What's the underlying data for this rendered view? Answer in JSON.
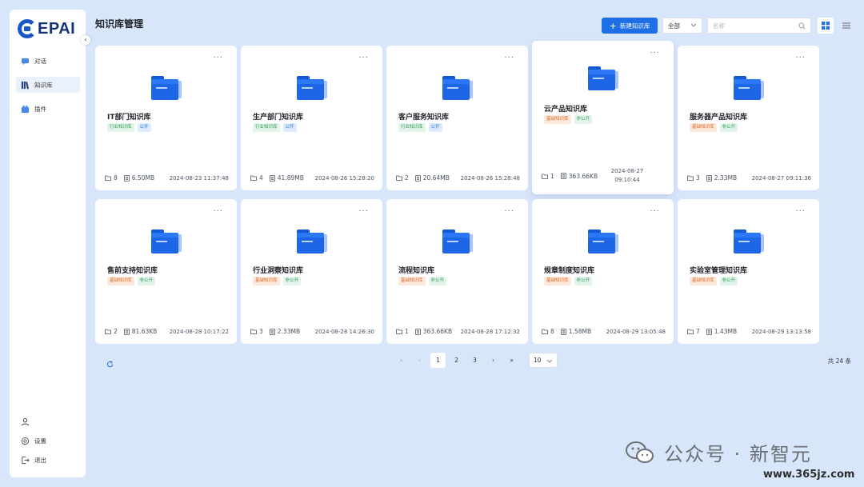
{
  "logo": {
    "text": "EPAI"
  },
  "sidebar": {
    "items": [
      {
        "label": "对话",
        "icon": "chat-icon",
        "active": false
      },
      {
        "label": "知识库",
        "icon": "library-icon",
        "active": true
      },
      {
        "label": "插件",
        "icon": "plugin-icon",
        "active": false
      }
    ],
    "bottom": [
      {
        "label": "",
        "icon": "user-icon"
      },
      {
        "label": "设置",
        "icon": "settings-icon"
      },
      {
        "label": "退出",
        "icon": "logout-icon"
      }
    ]
  },
  "header": {
    "title": "知识库管理",
    "new_button": "新建知识库",
    "filter_value": "全部",
    "search_placeholder": "名称"
  },
  "colors": {
    "primary": "#1e6ee6",
    "background": "#d8e6fb"
  },
  "cards": [
    {
      "name": "IT部门知识库",
      "tags": [
        {
          "text": "行业知识库",
          "color": "green"
        },
        {
          "text": "公开",
          "color": "blue"
        }
      ],
      "files": "8",
      "size": "6.50MB",
      "date": "2024-08-23 11:37:48"
    },
    {
      "name": "生产部门知识库",
      "tags": [
        {
          "text": "行业知识库",
          "color": "green"
        },
        {
          "text": "公开",
          "color": "blue"
        }
      ],
      "files": "4",
      "size": "41.89MB",
      "date": "2024-08-26 15:28:20"
    },
    {
      "name": "客户服务知识库",
      "tags": [
        {
          "text": "行业知识库",
          "color": "green"
        },
        {
          "text": "公开",
          "color": "blue"
        }
      ],
      "files": "2",
      "size": "20.64MB",
      "date": "2024-08-26 15:28:48"
    },
    {
      "name": "云产品知识库",
      "tags": [
        {
          "text": "基础知识库",
          "color": "orange"
        },
        {
          "text": "非公开",
          "color": "green"
        }
      ],
      "files": "1",
      "size": "363.66KB",
      "date": "2024-08-27 09:10:44",
      "raised": true
    },
    {
      "name": "服务器产品知识库",
      "tags": [
        {
          "text": "基础知识库",
          "color": "orange"
        },
        {
          "text": "非公开",
          "color": "green"
        }
      ],
      "files": "3",
      "size": "2.33MB",
      "date": "2024-08-27 09:11:36"
    },
    {
      "name": "售前支持知识库",
      "tags": [
        {
          "text": "基础知识库",
          "color": "orange"
        },
        {
          "text": "非公开",
          "color": "green"
        }
      ],
      "files": "2",
      "size": "81.63KB",
      "date": "2024-08-28 10:17:22"
    },
    {
      "name": "行业洞察知识库",
      "tags": [
        {
          "text": "基础知识库",
          "color": "orange"
        },
        {
          "text": "非公开",
          "color": "green"
        }
      ],
      "files": "3",
      "size": "2.33MB",
      "date": "2024-08-28 14:26:30"
    },
    {
      "name": "流程知识库",
      "tags": [
        {
          "text": "基础知识库",
          "color": "orange"
        },
        {
          "text": "非公开",
          "color": "green"
        }
      ],
      "files": "1",
      "size": "363.66KB",
      "date": "2024-08-28 17:12:32"
    },
    {
      "name": "规章制度知识库",
      "tags": [
        {
          "text": "基础知识库",
          "color": "orange"
        },
        {
          "text": "非公开",
          "color": "green"
        }
      ],
      "files": "8",
      "size": "1.58MB",
      "date": "2024-08-29 13:05:48"
    },
    {
      "name": "实验室管理知识库",
      "tags": [
        {
          "text": "基础知识库",
          "color": "orange"
        },
        {
          "text": "非公开",
          "color": "green"
        }
      ],
      "files": "7",
      "size": "1.43MB",
      "date": "2024-08-29 13:13:58"
    }
  ],
  "pagination": {
    "pages": [
      "1",
      "2",
      "3"
    ],
    "current": "1",
    "first": "«",
    "prev": "‹",
    "next": "›",
    "last": "»",
    "page_size": "10",
    "total": "共 24 条"
  },
  "watermark": {
    "text": "公众号 · 新智元",
    "site": "www.365jz.com"
  }
}
